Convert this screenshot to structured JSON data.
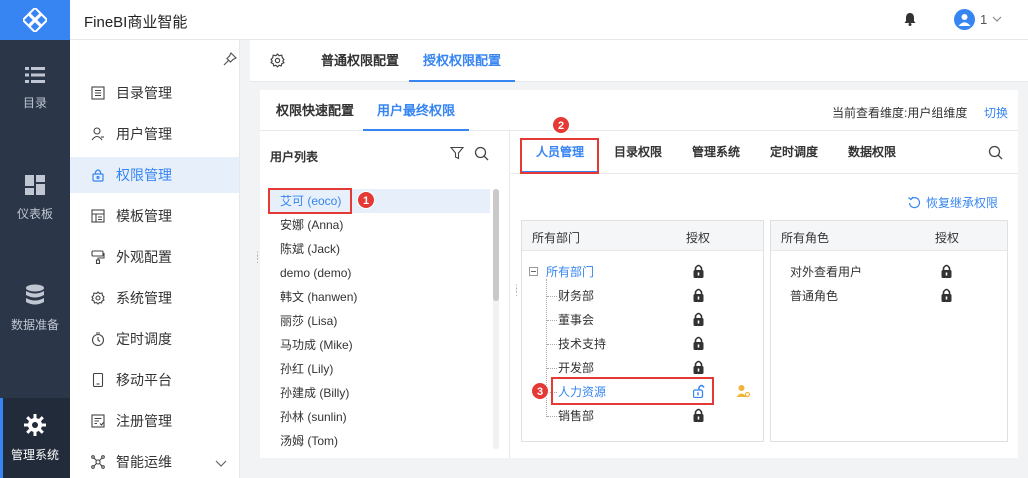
{
  "header": {
    "app_title": "FineBI商业智能",
    "user_name": "1"
  },
  "rail": {
    "items": [
      {
        "label": "目录",
        "icon": "list-icon"
      },
      {
        "label": "仪表板",
        "icon": "dashboard-icon"
      },
      {
        "label": "数据准备",
        "icon": "database-icon"
      },
      {
        "label": "管理系统",
        "icon": "gear-icon",
        "active": true
      }
    ]
  },
  "submenu": {
    "items": [
      {
        "label": "目录管理",
        "icon": "catalog-icon"
      },
      {
        "label": "用户管理",
        "icon": "user-icon"
      },
      {
        "label": "权限管理",
        "icon": "lock-icon",
        "active": true
      },
      {
        "label": "模板管理",
        "icon": "template-icon"
      },
      {
        "label": "外观配置",
        "icon": "brush-icon"
      },
      {
        "label": "系统管理",
        "icon": "settings-icon"
      },
      {
        "label": "定时调度",
        "icon": "timer-icon"
      },
      {
        "label": "移动平台",
        "icon": "mobile-icon"
      },
      {
        "label": "注册管理",
        "icon": "register-icon"
      },
      {
        "label": "智能运维",
        "icon": "ops-icon"
      }
    ]
  },
  "top_tabs": [
    {
      "label": "普通权限配置"
    },
    {
      "label": "授权权限配置",
      "active": true
    }
  ],
  "sub_tabs": [
    {
      "label": "权限快速配置"
    },
    {
      "label": "用户最终权限",
      "active": true
    }
  ],
  "dimension_text": "当前查看维度:用户组维度",
  "switch_label": "切换",
  "user_list": {
    "title": "用户列表",
    "users": [
      "艾可 (eoco)",
      "安娜 (Anna)",
      "陈斌 (Jack)",
      "demo (demo)",
      "韩文 (hanwen)",
      "丽莎 (Lisa)",
      "马功成 (Mike)",
      "孙红 (Lily)",
      "孙建成 (Billy)",
      "孙林 (sunlin)",
      "汤姆 (Tom)"
    ],
    "selected": 0
  },
  "perm_tabs": [
    {
      "label": "人员管理",
      "active": true
    },
    {
      "label": "目录权限"
    },
    {
      "label": "管理系统"
    },
    {
      "label": "定时调度"
    },
    {
      "label": "数据权限"
    }
  ],
  "restore_label": "恢复继承权限",
  "dept_box": {
    "col1": "所有部门",
    "col2": "授权",
    "root": "所有部门",
    "children": [
      "财务部",
      "董事会",
      "技术支持",
      "开发部",
      "人力资源",
      "销售部"
    ],
    "highlighted": "人力资源"
  },
  "role_box": {
    "col1": "所有角色",
    "col2": "授权",
    "roles": [
      "对外查看用户",
      "普通角色"
    ]
  },
  "annotations": [
    "1",
    "2",
    "3"
  ],
  "colors": {
    "accent": "#3685f2",
    "rail": "#2b3648",
    "annotation": "#e53935"
  }
}
